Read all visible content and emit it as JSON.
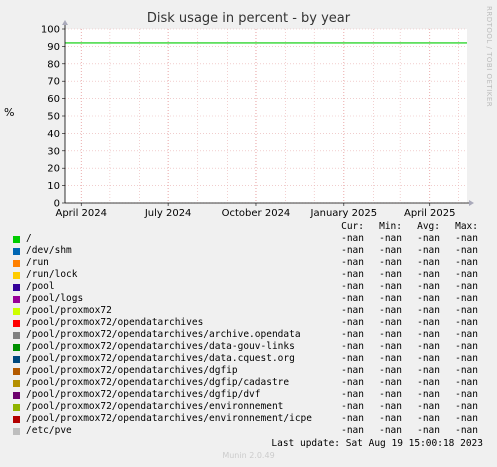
{
  "chart_data": {
    "type": "line",
    "title": "Disk usage in percent - by year",
    "ylabel": "%",
    "ylim": [
      0,
      100
    ],
    "yticks": [
      0,
      10,
      20,
      30,
      40,
      50,
      60,
      70,
      80,
      90,
      100
    ],
    "xlim": [
      "2024-03-15",
      "2025-05-10"
    ],
    "xticks": [
      {
        "date": "2024-04-01",
        "label": "April 2024"
      },
      {
        "date": "2024-07-01",
        "label": "July 2024"
      },
      {
        "date": "2024-10-01",
        "label": "October 2024"
      },
      {
        "date": "2025-01-01",
        "label": "January 2025"
      },
      {
        "date": "2025-04-01",
        "label": "April 2025"
      }
    ],
    "warning_line": {
      "value": 92,
      "color": "#00cc00"
    },
    "grid": true
  },
  "side_label": "RRDTOOL / TOBI OETIKER",
  "legend_header": {
    "cur": "Cur:",
    "min": "Min:",
    "avg": "Avg:",
    "max": "Max:"
  },
  "legend": [
    {
      "label": "/",
      "color": "#00cc00",
      "cur": "-nan",
      "min": "-nan",
      "avg": "-nan",
      "max": "-nan"
    },
    {
      "label": "/dev/shm",
      "color": "#0066b3",
      "cur": "-nan",
      "min": "-nan",
      "avg": "-nan",
      "max": "-nan"
    },
    {
      "label": "/run",
      "color": "#ff8000",
      "cur": "-nan",
      "min": "-nan",
      "avg": "-nan",
      "max": "-nan"
    },
    {
      "label": "/run/lock",
      "color": "#ffcc00",
      "cur": "-nan",
      "min": "-nan",
      "avg": "-nan",
      "max": "-nan"
    },
    {
      "label": "/pool",
      "color": "#330099",
      "cur": "-nan",
      "min": "-nan",
      "avg": "-nan",
      "max": "-nan"
    },
    {
      "label": "/pool/logs",
      "color": "#990099",
      "cur": "-nan",
      "min": "-nan",
      "avg": "-nan",
      "max": "-nan"
    },
    {
      "label": "/pool/proxmox72",
      "color": "#ccff00",
      "cur": "-nan",
      "min": "-nan",
      "avg": "-nan",
      "max": "-nan"
    },
    {
      "label": "/pool/proxmox72/opendatarchives",
      "color": "#ff0000",
      "cur": "-nan",
      "min": "-nan",
      "avg": "-nan",
      "max": "-nan"
    },
    {
      "label": "/pool/proxmox72/opendatarchives/archive.opendata",
      "color": "#808080",
      "cur": "-nan",
      "min": "-nan",
      "avg": "-nan",
      "max": "-nan"
    },
    {
      "label": "/pool/proxmox72/opendatarchives/data-gouv-links",
      "color": "#008f00",
      "cur": "-nan",
      "min": "-nan",
      "avg": "-nan",
      "max": "-nan"
    },
    {
      "label": "/pool/proxmox72/opendatarchives/data.cquest.org",
      "color": "#00487d",
      "cur": "-nan",
      "min": "-nan",
      "avg": "-nan",
      "max": "-nan"
    },
    {
      "label": "/pool/proxmox72/opendatarchives/dgfip",
      "color": "#b35a00",
      "cur": "-nan",
      "min": "-nan",
      "avg": "-nan",
      "max": "-nan"
    },
    {
      "label": "/pool/proxmox72/opendatarchives/dgfip/cadastre",
      "color": "#b38f00",
      "cur": "-nan",
      "min": "-nan",
      "avg": "-nan",
      "max": "-nan"
    },
    {
      "label": "/pool/proxmox72/opendatarchives/dgfip/dvf",
      "color": "#6b006b",
      "cur": "-nan",
      "min": "-nan",
      "avg": "-nan",
      "max": "-nan"
    },
    {
      "label": "/pool/proxmox72/opendatarchives/environnement",
      "color": "#8fb300",
      "cur": "-nan",
      "min": "-nan",
      "avg": "-nan",
      "max": "-nan"
    },
    {
      "label": "/pool/proxmox72/opendatarchives/environnement/icpe",
      "color": "#b30000",
      "cur": "-nan",
      "min": "-nan",
      "avg": "-nan",
      "max": "-nan"
    },
    {
      "label": "/etc/pve",
      "color": "#bebebe",
      "cur": "-nan",
      "min": "-nan",
      "avg": "-nan",
      "max": "-nan"
    }
  ],
  "footer": "Last update: Sat Aug 19 15:00:18 2023",
  "munin_version": "Munin 2.0.49"
}
